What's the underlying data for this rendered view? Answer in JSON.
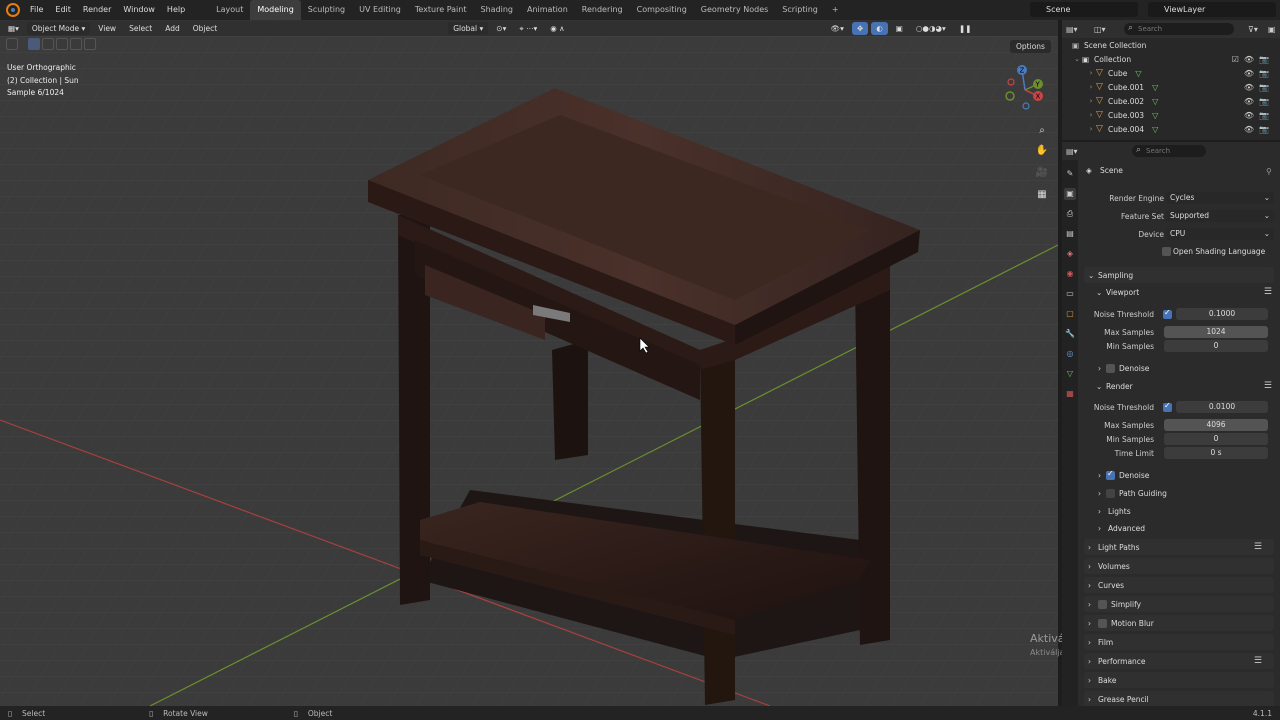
{
  "topbar": {
    "menus": [
      "File",
      "Edit",
      "Render",
      "Window",
      "Help"
    ],
    "workspaces": [
      "Layout",
      "Modeling",
      "Sculpting",
      "UV Editing",
      "Texture Paint",
      "Shading",
      "Animation",
      "Rendering",
      "Compositing",
      "Geometry Nodes",
      "Scripting"
    ],
    "active_workspace": "Modeling",
    "add_tab": "+",
    "scene": "Scene",
    "view_layer": "ViewLayer"
  },
  "viewport": {
    "mode": "Object Mode",
    "menus": [
      "View",
      "Select",
      "Add",
      "Object"
    ],
    "transform_orientation": "Global",
    "options": "Options",
    "info_lines": [
      "User Orthographic",
      "(2) Collection | Sun",
      "Sample 6/1024"
    ],
    "watermark_title": "Aktiválja a Windowst",
    "watermark_sub": "Aktiválja a Windows rendszert a Gépházban.",
    "axis_x": "X",
    "axis_y": "Y",
    "axis_z": "Z"
  },
  "outliner": {
    "search_placeholder": "Search",
    "root": "Scene Collection",
    "collection": "Collection",
    "objects": [
      "Cube",
      "Cube.001",
      "Cube.002",
      "Cube.003",
      "Cube.004"
    ]
  },
  "properties": {
    "search_placeholder": "Search",
    "context": "Scene",
    "render_engine_label": "Render Engine",
    "render_engine": "Cycles",
    "feature_set_label": "Feature Set",
    "feature_set": "Supported",
    "device_label": "Device",
    "device": "CPU",
    "osl": "Open Shading Language",
    "sampling": "Sampling",
    "viewport_section": "Viewport",
    "noise_threshold_label": "Noise Threshold",
    "vp_noise_threshold": "0.1000",
    "max_samples_label": "Max Samples",
    "vp_max_samples": "1024",
    "min_samples_label": "Min Samples",
    "vp_min_samples": "0",
    "denoise": "Denoise",
    "render_section": "Render",
    "r_noise_threshold": "0.0100",
    "r_max_samples": "4096",
    "r_min_samples": "0",
    "time_limit_label": "Time Limit",
    "r_time_limit": "0 s",
    "path_guiding": "Path Guiding",
    "lights": "Lights",
    "advanced": "Advanced",
    "sections": [
      "Light Paths",
      "Volumes",
      "Curves",
      "Simplify",
      "Motion Blur",
      "Film",
      "Performance",
      "Bake",
      "Grease Pencil"
    ]
  },
  "status": {
    "select": "Select",
    "rotate": "Rotate View",
    "object": "Object",
    "version": "4.1.1"
  }
}
